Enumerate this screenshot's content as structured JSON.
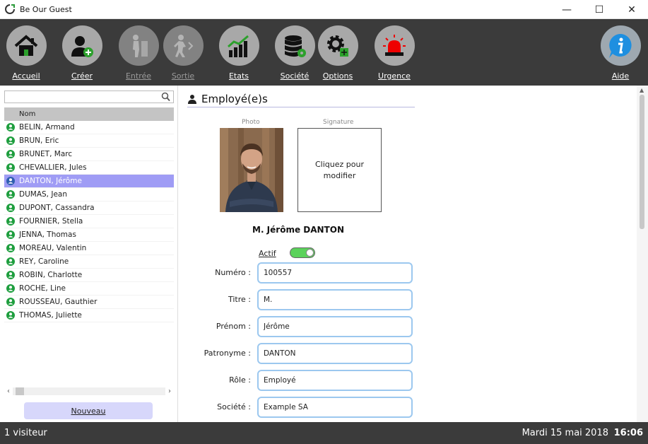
{
  "window": {
    "title": "Be Our Guest",
    "controls": {
      "minimize": "—",
      "maximize": "☐",
      "close": "✕"
    }
  },
  "toolbar": {
    "items": [
      {
        "label": "Accueil",
        "icon": "home-icon",
        "enabled": true
      },
      {
        "label": "Créer",
        "icon": "add-user-icon",
        "enabled": true
      },
      {
        "label": "Entrée",
        "icon": "entry-icon",
        "enabled": false
      },
      {
        "label": "Sortie",
        "icon": "exit-icon",
        "enabled": false
      },
      {
        "label": "Etats",
        "icon": "chart-icon",
        "enabled": true
      },
      {
        "label": "Société",
        "icon": "database-icon",
        "enabled": true
      },
      {
        "label": "Options",
        "icon": "gear-icon",
        "enabled": true
      },
      {
        "label": "Urgence",
        "icon": "alarm-icon",
        "enabled": true
      }
    ],
    "help": {
      "label": "Aide",
      "icon": "info-icon"
    }
  },
  "sidebar": {
    "search": {
      "value": "",
      "placeholder": ""
    },
    "column_header": "Nom",
    "employees": [
      "BELIN, Armand",
      "BRUN, Eric",
      "BRUNET, Marc",
      "CHEVALLIER, Jules",
      "DANTON, Jérôme",
      "DUMAS, Jean",
      "DUPONT, Cassandra",
      "FOURNIER, Stella",
      "JENNA, Thomas",
      "MOREAU, Valentin",
      "REY, Caroline",
      "ROBIN, Charlotte",
      "ROCHE, Line",
      "ROUSSEAU, Gauthier",
      "THOMAS, Juliette"
    ],
    "selected_index": 4,
    "new_button": "Nouveau"
  },
  "detail": {
    "section_title": "Employé(e)s",
    "photo_caption": "Photo",
    "signature_caption": "Signature",
    "signature_placeholder": "Cliquez pour modifier",
    "full_name": "M. Jérôme DANTON",
    "active_label": "Actif",
    "active": true,
    "fields": [
      {
        "label": "Numéro :",
        "value": "100557"
      },
      {
        "label": "Titre :",
        "value": "M."
      },
      {
        "label": "Prénom :",
        "value": "Jérôme"
      },
      {
        "label": "Patronyme :",
        "value": "DANTON"
      },
      {
        "label": "Rôle :",
        "value": "Employé"
      },
      {
        "label": "Société :",
        "value": "Example SA"
      }
    ]
  },
  "status": {
    "visitors": "1 visiteur",
    "date": "Mardi 15 mai 2018",
    "time": "16:06"
  },
  "colors": {
    "toolbar_bg": "#3b3b3b",
    "selection": "#9f9cf5",
    "input_border": "#9cc8ef",
    "toggle_on": "#5bd25b",
    "status_green": "#1e9e3e"
  }
}
